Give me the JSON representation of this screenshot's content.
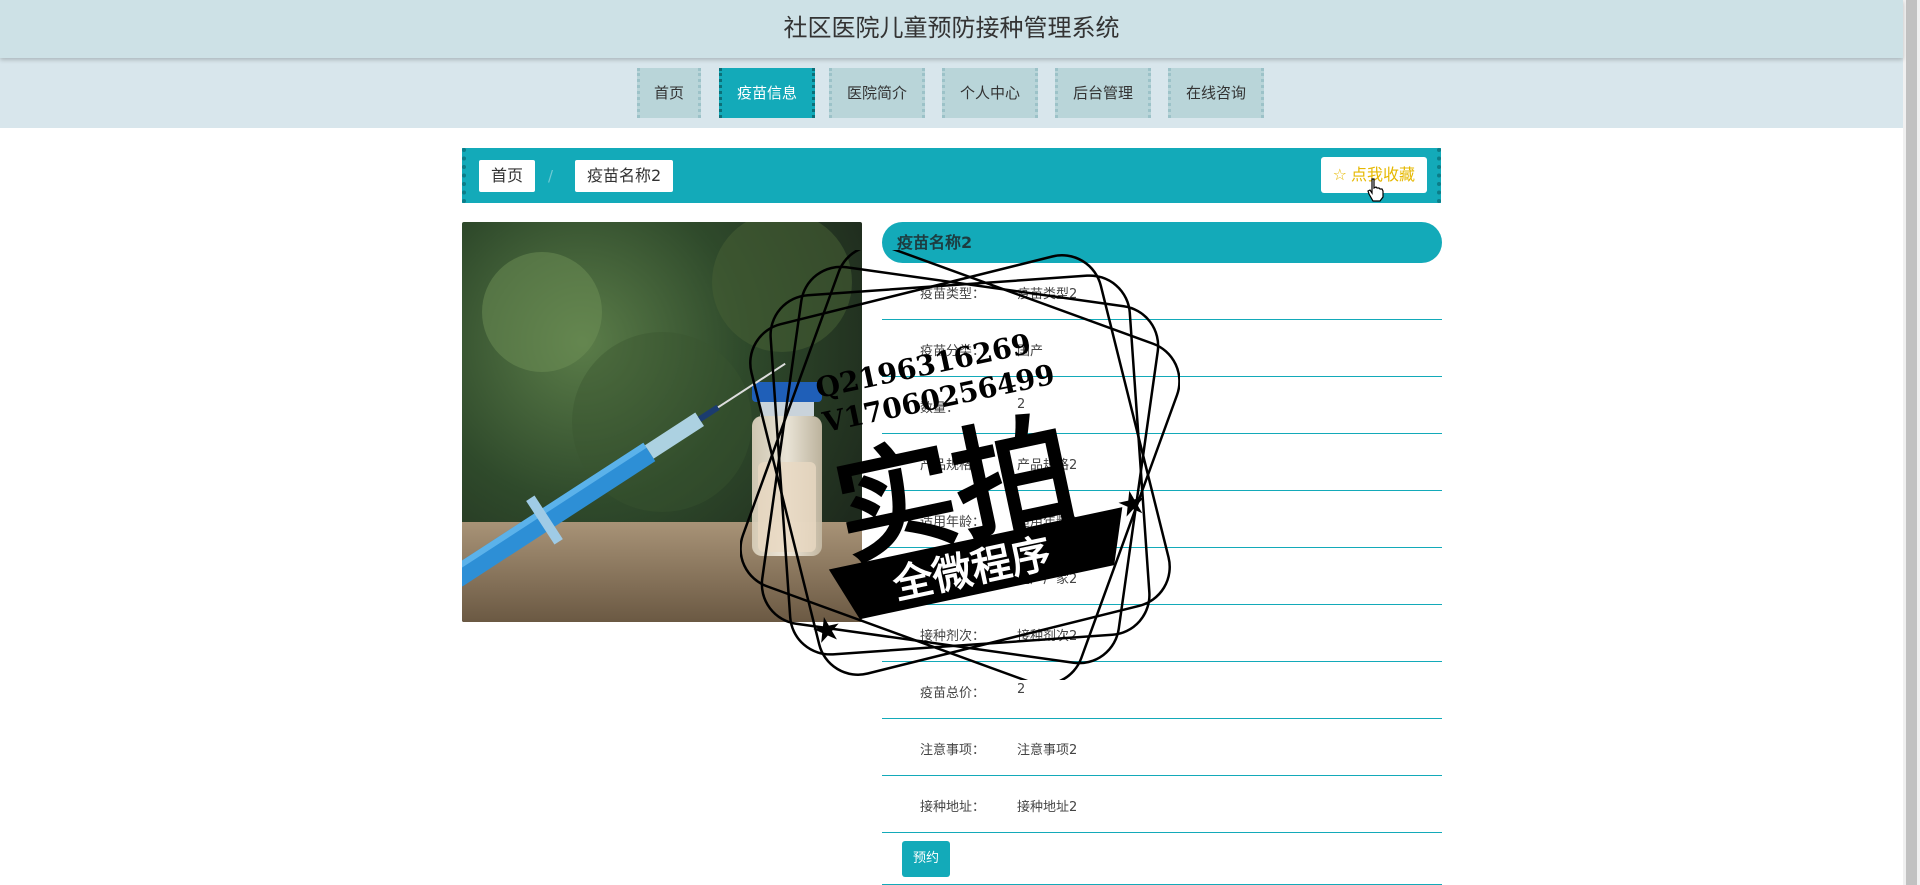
{
  "header": {
    "title": "社区医院儿童预防接种管理系统"
  },
  "nav": {
    "items": [
      {
        "label": "首页"
      },
      {
        "label": "疫苗信息"
      },
      {
        "label": "医院简介"
      },
      {
        "label": "个人中心"
      },
      {
        "label": "后台管理"
      },
      {
        "label": "在线咨询"
      }
    ]
  },
  "breadcrumb": {
    "home": "首页",
    "separator": "/",
    "current": "疫苗名称2"
  },
  "favorite": {
    "label": "点我收藏",
    "icon": "star-outline-icon"
  },
  "detail": {
    "title": "疫苗名称2",
    "rows": [
      {
        "label": "疫苗类型：",
        "value": "疫苗类型2"
      },
      {
        "label": "疫苗分类：",
        "value": "国产"
      },
      {
        "label": "数量：",
        "value": "2"
      },
      {
        "label": "产品规格：",
        "value": "产品规格2"
      },
      {
        "label": "适用年龄：",
        "value": "适用年龄2"
      },
      {
        "label": "生产厂家：",
        "value": "生产厂家2"
      },
      {
        "label": "接种剂次：",
        "value": "接种剂次2"
      },
      {
        "label": "疫苗总价：",
        "value": "2"
      },
      {
        "label": "注意事项：",
        "value": "注意事项2"
      },
      {
        "label": "接种地址：",
        "value": "接种地址2"
      }
    ],
    "reserve_label": "预约"
  },
  "watermark": {
    "line1": "Q2196316269",
    "line2": "V17060256499",
    "big": "实拍",
    "banner": "全微程序"
  },
  "colors": {
    "accent": "#13aab9",
    "header_bg": "#cde1e6",
    "nav_bg": "#d8e6ec",
    "fav": "#e6b800"
  }
}
